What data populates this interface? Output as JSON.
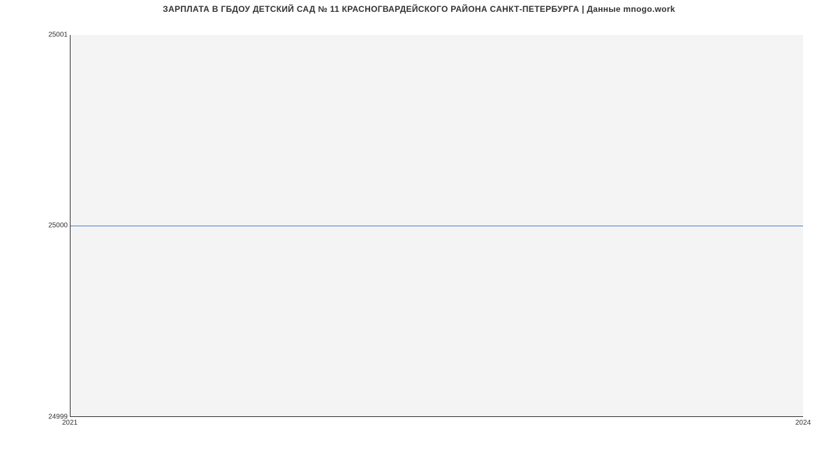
{
  "chart_data": {
    "type": "line",
    "title": "ЗАРПЛАТА В ГБДОУ ДЕТСКИЙ САД № 11 КРАСНОГВАРДЕЙСКОГО РАЙОНА САНКТ-ПЕТЕРБУРГА | Данные mnogo.work",
    "x": [
      2021,
      2024
    ],
    "values": [
      25000,
      25000
    ],
    "x_ticks": [
      "2021",
      "2024"
    ],
    "y_ticks": [
      "24999",
      "25000",
      "25001"
    ],
    "xlim": [
      2021,
      2024
    ],
    "ylim": [
      24999,
      25001
    ],
    "xlabel": "",
    "ylabel": "",
    "grid": false,
    "legend": false,
    "plot_bg": "#f4f4f4",
    "line_color": "#4a7ec8"
  }
}
